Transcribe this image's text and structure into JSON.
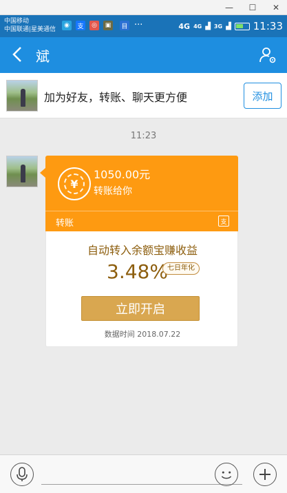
{
  "window": {
    "minimize": "—",
    "maximize": "☐",
    "close": "✕"
  },
  "status_bar": {
    "carrier_1": "中国移动",
    "carrier_2": "中国联通|星美通信",
    "notification_icons": [
      "wechat-icon",
      "alipay-icon",
      "app-icon",
      "photo-icon",
      "app-icon-2"
    ],
    "more": "···",
    "network_1": "4G",
    "network_2": "4G",
    "network_3": "3G",
    "time": "11:33"
  },
  "header": {
    "title": "斌",
    "back_icon": "back-arrow-icon",
    "profile_icon": "contact-settings-icon"
  },
  "banner": {
    "text": "加为好友，转账、聊天更方便",
    "add_label": "添加"
  },
  "chat": {
    "timestamp": "11:23"
  },
  "transfer_card": {
    "amount": "1050.00元",
    "subtitle": "转账给你",
    "tag": "转账",
    "promo": "自动转入余额宝赚收益",
    "rate": "3.48%",
    "rate_badge": "七日年化",
    "button": "立即开启",
    "data_time": "数据时间 2018.07.22",
    "colors": {
      "accent": "#fe9a11",
      "gold_button": "#d9a750",
      "gold_text": "#8d5e0e"
    }
  },
  "colors": {
    "status_bar": "#1a73b8",
    "title_bar": "#1e8ee0",
    "background": "#ebebeb"
  }
}
